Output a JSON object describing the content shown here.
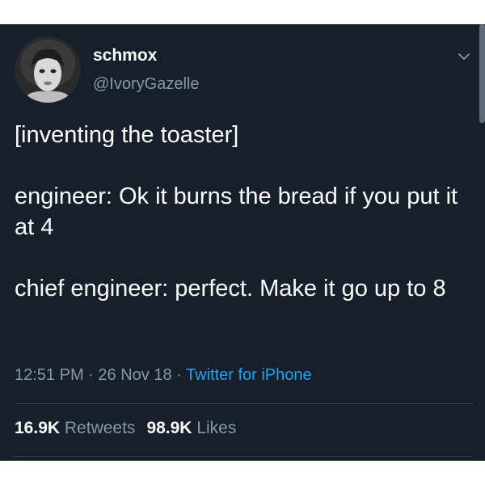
{
  "user": {
    "display_name": "schmox",
    "handle": "@IvoryGazelle"
  },
  "tweet": {
    "paragraphs": [
      "[inventing the toaster]",
      "engineer: Ok it burns the bread if you put it at 4",
      "chief engineer: perfect. Make it go up to 8"
    ],
    "time": "12:51 PM",
    "date": "26 Nov 18",
    "separator": "·",
    "source": "Twitter for iPhone"
  },
  "stats": {
    "retweets_count": "16.9K",
    "retweets_label": "Retweets",
    "likes_count": "98.9K",
    "likes_label": "Likes"
  },
  "icons": {
    "menu": "chevron-down-icon",
    "avatar": "avatar"
  },
  "colors": {
    "background": "#15202b",
    "text": "#ffffff",
    "secondary_text": "#8899a6",
    "link": "#1da1f2",
    "divider": "#38444d"
  }
}
